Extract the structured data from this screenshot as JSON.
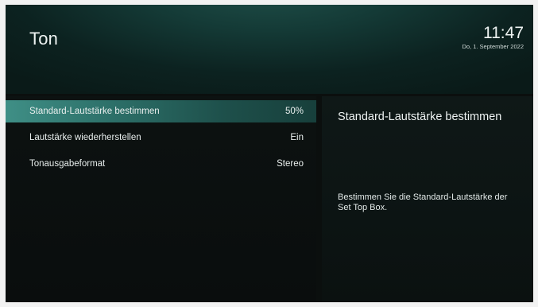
{
  "header": {
    "title": "Ton",
    "time": "11:47",
    "date": "Do, 1. September 2022"
  },
  "menu": {
    "items": [
      {
        "label": "Standard-Lautstärke bestimmen",
        "value": "50%",
        "selected": true
      },
      {
        "label": "Lautstärke wiederherstellen",
        "value": "Ein",
        "selected": false
      },
      {
        "label": "Tonausgabeformat",
        "value": "Stereo",
        "selected": false
      }
    ]
  },
  "detail": {
    "title": "Standard-Lautstärke bestimmen",
    "description": "Bestimmen Sie die Standard-Lautstärke der Set Top Box."
  },
  "colors": {
    "accent": "#3f8f86",
    "background": "#0b0f0e",
    "header": "#143a36",
    "text": "#eef3f2"
  }
}
